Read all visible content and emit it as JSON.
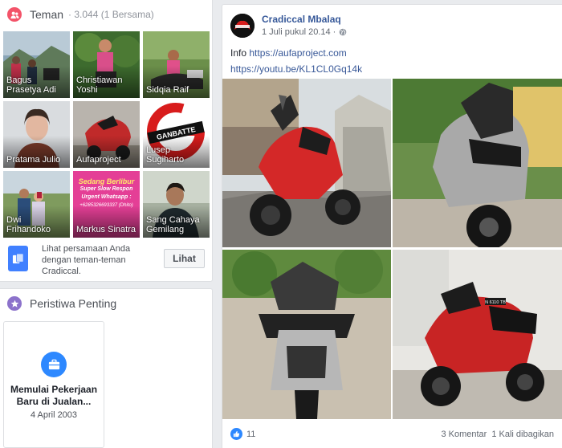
{
  "friends": {
    "title": "Teman",
    "count": "· 3.044 (1 Bersama)",
    "icon": "friends-icon",
    "icon_color": "#f35369",
    "items": [
      {
        "name": "Bagus Prasetya Adi"
      },
      {
        "name": "Christiawan Yoshi"
      },
      {
        "name": "Sidqia Raif"
      },
      {
        "name": "Pratama Julio"
      },
      {
        "name": "Aufaproject"
      },
      {
        "name": "Lusep Sugiharto"
      },
      {
        "name": "Dwi Frihandoko"
      },
      {
        "name": "Markus Sinatra"
      },
      {
        "name": "Sang Cahaya Gemilang"
      }
    ],
    "mutual_text": "Lihat persamaan Anda dengan teman-teman Cradiccal.",
    "mutual_button": "Lihat",
    "tile_texts": {
      "gambatte": "GANBATTE",
      "promo_lines": [
        "Sedang Berlibur",
        "Super Slow Respon",
        "Urgent Whatsapp :",
        "+6285326693337 (Dhito)"
      ]
    }
  },
  "life_events": {
    "title": "Peristiwa Penting",
    "icon": "star-icon",
    "icon_color": "#8c72cb",
    "items": [
      {
        "title": "Memulai Pekerjaan Baru di Jualan...",
        "date": "4 April 2003",
        "icon": "briefcase-icon"
      }
    ]
  },
  "post": {
    "author": "Cradiccal Mbalaq",
    "timestamp": "1 Juli pukul 20.14 ·",
    "privacy_icon": "globe-icon",
    "text_prefix": "Info",
    "link1": "https://aufaproject.com",
    "link2": "https://youtu.be/KL1CL0Gq14k",
    "plate_text": "N 6110 TB",
    "reactions": {
      "count": "11",
      "icon": "like-icon"
    },
    "comments": "3 Komentar",
    "shares": "1 Kali dibagikan",
    "link_color": "#385898"
  },
  "colors": {
    "background": "#e9ebee",
    "card": "#ffffff",
    "border": "#dddfe2",
    "author_link": "#365899",
    "like_blue": "#2d88ff"
  }
}
